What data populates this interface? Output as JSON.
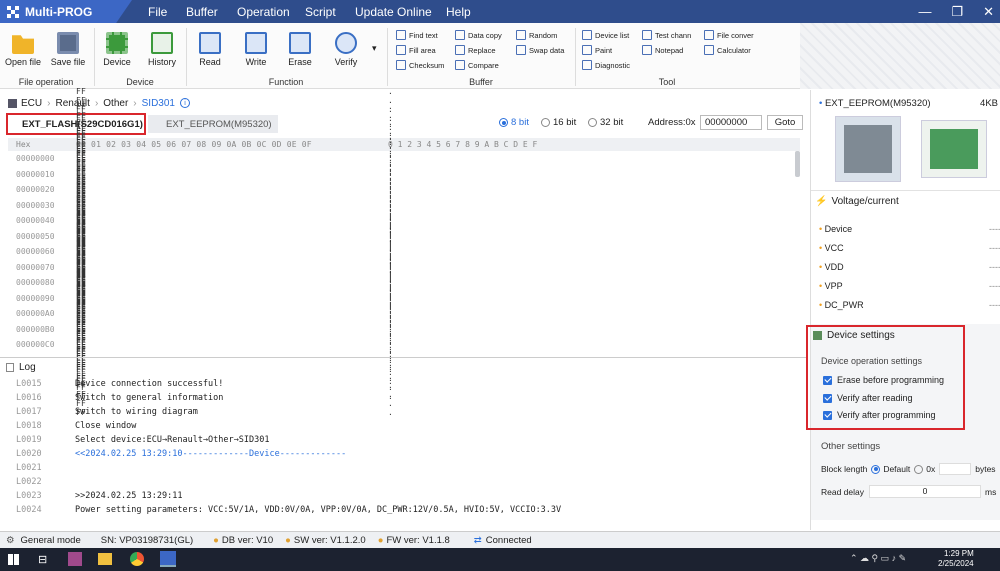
{
  "app": {
    "title": "Multi-PROG"
  },
  "menu": [
    "File",
    "Buffer",
    "Operation",
    "Script",
    "Update Online",
    "Help"
  ],
  "ribbon": {
    "file_group": {
      "label": "File operation",
      "buttons": [
        "Open file",
        "Save file"
      ]
    },
    "device_group": {
      "label": "Device",
      "buttons": [
        "Device",
        "History"
      ]
    },
    "function_group": {
      "label": "Function",
      "buttons": [
        "Read",
        "Write",
        "Erase",
        "Verify"
      ]
    },
    "buffer_group": {
      "label": "Buffer",
      "col1": [
        "Find text",
        "Fill area",
        "Checksum"
      ],
      "col2": [
        "Data copy",
        "Replace",
        "Compare"
      ],
      "col3": [
        "Random",
        "Swap data"
      ]
    },
    "tool_group": {
      "label": "Tool",
      "col1": [
        "Device list",
        "Paint",
        "Diagnostic"
      ],
      "col2": [
        "Test chann",
        "Notepad"
      ],
      "col3": [
        "File conver",
        "Calculator"
      ]
    }
  },
  "breadcrumb": [
    "ECU",
    "Renault",
    "Other",
    "SID301"
  ],
  "tabs": [
    "EXT_FLASH(S29CD016G1)",
    "EXT_EEPROM(M95320)"
  ],
  "view": {
    "bit_options": [
      "8 bit",
      "16 bit",
      "32 bit"
    ],
    "selected_bit": "8 bit",
    "address_label": "Address:0x",
    "address_value": "00000000",
    "goto_label": "Goto"
  },
  "hex": {
    "header_label": "Hex",
    "columns": "00 01 02 03 04 05 06 07 08 09 0A 0B 0C 0D 0E 0F",
    "ascii_columns": "0 1 2 3 4 5 6 7 8 9 A B C D E F",
    "rows": [
      {
        "addr": "00000000",
        "bytes": "FF FF FF FF FF FF FF FF FF FF FF FF FF FF FF FF",
        "ascii": ". . . . . . . . . . . . . . . ."
      },
      {
        "addr": "00000010",
        "bytes": "FF FF FF FF FF FF FF FF FF FF FF FF FF FF FF FF",
        "ascii": ". . . . . . . . . . . . . . . ."
      },
      {
        "addr": "00000020",
        "bytes": "FF FF FF FF FF FF FF FF FF FF FF FF FF FF FF FF",
        "ascii": ". . . . . . . . . . . . . . . ."
      },
      {
        "addr": "00000030",
        "bytes": "FF FF FF FF FF FF FF FF FF FF FF FF FF FF FF FF",
        "ascii": ". . . . . . . . . . . . . . . ."
      },
      {
        "addr": "00000040",
        "bytes": "FF FF FF FF FF FF FF FF FF FF FF FF FF FF FF FF",
        "ascii": ". . . . . . . . . . . . . . . ."
      },
      {
        "addr": "00000050",
        "bytes": "FF FF FF FF FF FF FF FF FF FF FF FF FF FF FF FF",
        "ascii": ". . . . . . . . . . . . . . . ."
      },
      {
        "addr": "00000060",
        "bytes": "FF FF FF FF FF FF FF FF FF FF FF FF FF FF FF FF",
        "ascii": ". . . . . . . . . . . . . . . ."
      },
      {
        "addr": "00000070",
        "bytes": "FF FF FF FF FF FF FF FF FF FF FF FF FF FF FF FF",
        "ascii": ". . . . . . . . . . . . . . . ."
      },
      {
        "addr": "00000080",
        "bytes": "FF FF FF FF FF FF FF FF FF FF FF FF FF FF FF FF",
        "ascii": ". . . . . . . . . . . . . . . ."
      },
      {
        "addr": "00000090",
        "bytes": "FF FF FF FF FF FF FF FF FF FF FF FF FF FF FF FF",
        "ascii": ". . . . . . . . . . . . . . . ."
      },
      {
        "addr": "000000A0",
        "bytes": "FF FF FF FF FF FF FF FF FF FF FF FF FF FF FF FF",
        "ascii": ". . . . . . . . . . . . . . . ."
      },
      {
        "addr": "000000B0",
        "bytes": "FF FF FF FF FF FF FF FF FF FF FF FF FF FF FF FF",
        "ascii": ". . . . . . . . . . . . . . . ."
      },
      {
        "addr": "000000C0",
        "bytes": "FF FF FF FF FF FF FF FF FF FF FF FF FF FF FF FF",
        "ascii": ". . . . . . . . . . . . . . . ."
      }
    ]
  },
  "log": {
    "title": "Log",
    "lines": [
      {
        "no": "L0015",
        "text": "Device connection successful!",
        "hl": false
      },
      {
        "no": "L0016",
        "text": "Switch to general information",
        "hl": false
      },
      {
        "no": "L0017",
        "text": "Switch to wiring diagram",
        "hl": false
      },
      {
        "no": "L0018",
        "text": "Close window",
        "hl": false
      },
      {
        "no": "L0019",
        "text": "Select device:ECU→Renault→Other→SID301",
        "hl": false
      },
      {
        "no": "L0020",
        "text": "<<2024.02.25 13:29:10-------------Device-------------",
        "hl": true
      },
      {
        "no": "L0021",
        "text": "",
        "hl": false
      },
      {
        "no": "L0022",
        "text": "",
        "hl": false
      },
      {
        "no": "L0023",
        "text": ">>2024.02.25 13:29:11",
        "hl": false
      },
      {
        "no": "L0024",
        "text": "Power setting parameters: VCC:5V/1A, VDD:0V/0A, VPP:0V/0A, DC_PWR:12V/0.5A, HVIO:5V, VCCIO:3.3V",
        "hl": false
      }
    ]
  },
  "right_panel": {
    "chip_name": "EXT_EEPROM(M95320)",
    "chip_size": "4KB",
    "voltage_title": "Voltage/current",
    "voltage_items": [
      {
        "label": "Device",
        "value": "----"
      },
      {
        "label": "VCC",
        "value": "----"
      },
      {
        "label": "VDD",
        "value": "----"
      },
      {
        "label": "VPP",
        "value": "----"
      },
      {
        "label": "DC_PWR",
        "value": "----"
      }
    ],
    "device_settings_title": "Device settings",
    "operation_settings_label": "Device operation settings",
    "checkboxes": [
      "Erase before programming",
      "Verify after reading",
      "Verify after programming"
    ],
    "other_settings_label": "Other settings",
    "block_length_label": "Block length",
    "block_default_label": "Default",
    "block_0x_label": "0x",
    "block_unit": "bytes",
    "read_delay_label": "Read delay",
    "read_delay_value": "0",
    "read_delay_unit": "ms"
  },
  "status": {
    "mode": "General mode",
    "sn": "SN:  VP03198731(GL)",
    "db": "DB ver: V10",
    "sw": "SW ver: V1.1.2.0",
    "fw": "FW ver: V1.1.8",
    "conn": "Connected"
  },
  "taskbar": {
    "time": "1:29 PM",
    "date": "2/25/2024"
  },
  "colors": {
    "titlebar": "#2f4d8c",
    "accent": "#2a6fdb",
    "highlight_box": "#d9262c"
  }
}
